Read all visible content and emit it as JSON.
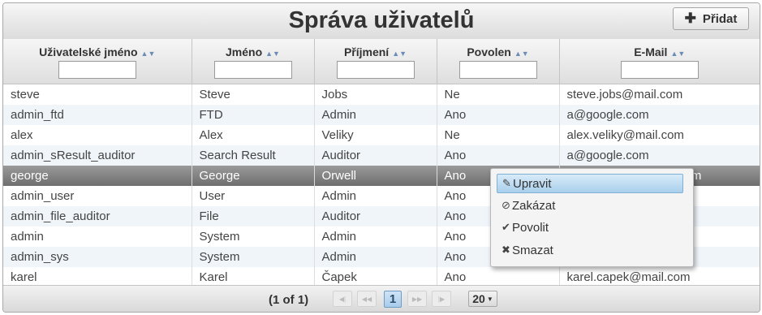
{
  "title": "Správa uživatelů",
  "add_button": {
    "icon": "plus-icon",
    "label": "Přidat"
  },
  "columns": [
    {
      "label": "Uživatelské jméno",
      "sort_icon": "sort-icon"
    },
    {
      "label": "Jméno",
      "sort_icon": "sort-icon"
    },
    {
      "label": "Příjmení",
      "sort_icon": "sort-icon"
    },
    {
      "label": "Povolen",
      "sort_icon": "sort-icon"
    },
    {
      "label": "E-Mail",
      "sort_icon": "sort-icon"
    }
  ],
  "rows": [
    {
      "username": "steve",
      "name": "Steve",
      "surname": "Jobs",
      "enabled": "Ne",
      "email": "steve.jobs@mail.com"
    },
    {
      "username": "admin_ftd",
      "name": "FTD",
      "surname": "Admin",
      "enabled": "Ano",
      "email": "a@google.com"
    },
    {
      "username": "alex",
      "name": "Alex",
      "surname": "Veliky",
      "enabled": "Ne",
      "email": "alex.veliky@mail.com"
    },
    {
      "username": "admin_sResult_auditor",
      "name": "Search Result",
      "surname": "Auditor",
      "enabled": "Ano",
      "email": "a@google.com"
    },
    {
      "username": "george",
      "name": "George",
      "surname": "Orwell",
      "enabled": "Ano",
      "email": "om"
    },
    {
      "username": "admin_user",
      "name": "User",
      "surname": "Admin",
      "enabled": "Ano",
      "email": ""
    },
    {
      "username": "admin_file_auditor",
      "name": "File",
      "surname": "Auditor",
      "enabled": "Ano",
      "email": ""
    },
    {
      "username": "admin",
      "name": "System",
      "surname": "Admin",
      "enabled": "Ano",
      "email": ""
    },
    {
      "username": "admin_sys",
      "name": "System",
      "surname": "Admin",
      "enabled": "Ano",
      "email": ""
    },
    {
      "username": "karel",
      "name": "Karel",
      "surname": "Čapek",
      "enabled": "Ano",
      "email": "karel.capek@mail.com"
    }
  ],
  "selected_row": "george",
  "context_menu": {
    "items": [
      {
        "label": "Upravit",
        "icon": "edit-icon",
        "active": true
      },
      {
        "label": "Zakázat",
        "icon": "disable-icon",
        "active": false
      },
      {
        "label": "Povolit",
        "icon": "check-icon",
        "active": false
      },
      {
        "label": "Smazat",
        "icon": "delete-icon",
        "active": false
      }
    ]
  },
  "paginator": {
    "page_info": "(1 of 1)",
    "current_page": "1",
    "rows_per_page": "20"
  }
}
